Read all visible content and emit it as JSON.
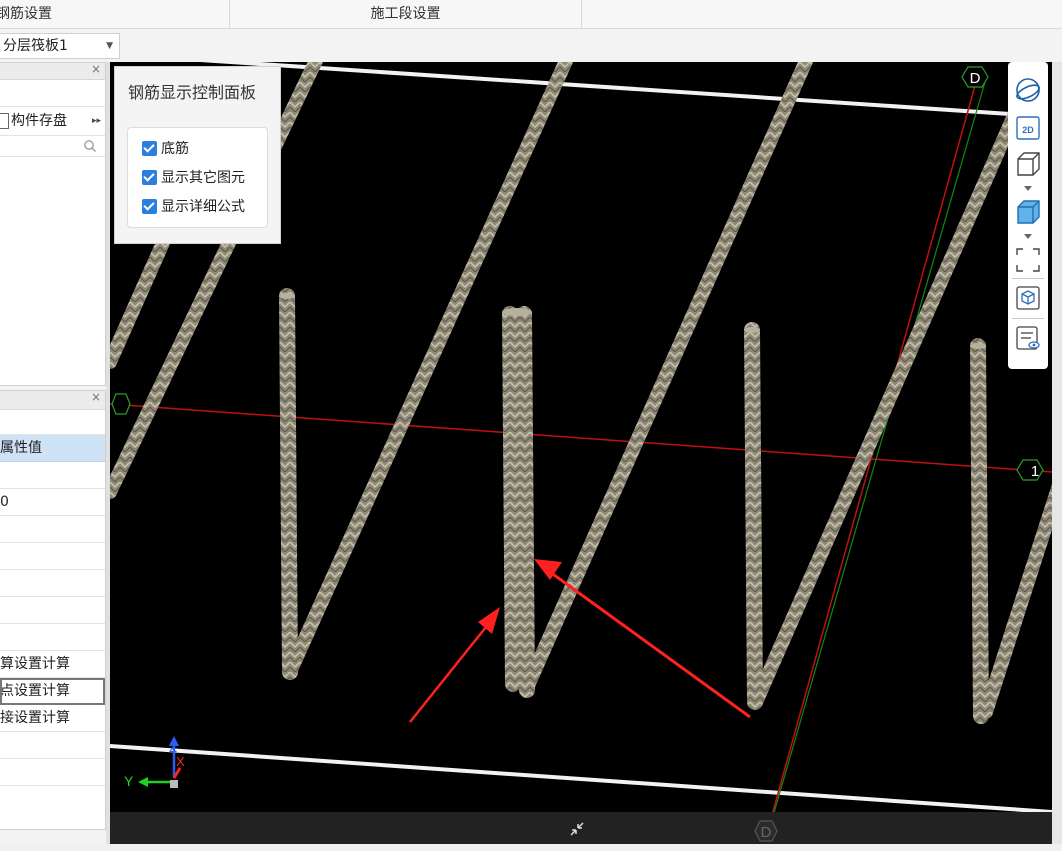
{
  "tabs": {
    "rebar_settings": "钢筋设置",
    "stage_settings": "施工段设置"
  },
  "layer_select": {
    "value": "分层筏板1"
  },
  "component_panel": {
    "save_label": "构件存盘"
  },
  "property_panel": {
    "header": "属性值",
    "rows": [
      "",
      "0",
      "",
      "",
      "",
      "",
      "",
      "算设置计算",
      "点设置计算",
      "接设置计算",
      "",
      ""
    ]
  },
  "rebar_panel": {
    "title": "钢筋显示控制面板",
    "options": [
      {
        "label": "底筋",
        "checked": true
      },
      {
        "label": "显示其它图元",
        "checked": true
      },
      {
        "label": "显示详细公式",
        "checked": true
      }
    ]
  },
  "viewport": {
    "axis_labels": {
      "top_d": "D",
      "bottom_d": "D",
      "right_1": "1"
    },
    "gizmo": {
      "y": "Y",
      "z": "Z",
      "x": "X"
    },
    "colors": {
      "background": "#000000",
      "red_axis": "#c01010",
      "green_axis": "#0f8a0f",
      "rebar": "#9e9680",
      "arrow": "#ff2020"
    }
  },
  "right_toolbar": {
    "icons": [
      "orbit-icon",
      "2d-view-icon",
      "3d-box-icon",
      "solid-box-icon",
      "zoom-extents-icon",
      "select-3d-icon",
      "display-settings-icon"
    ],
    "view_2d_label": "2D"
  }
}
